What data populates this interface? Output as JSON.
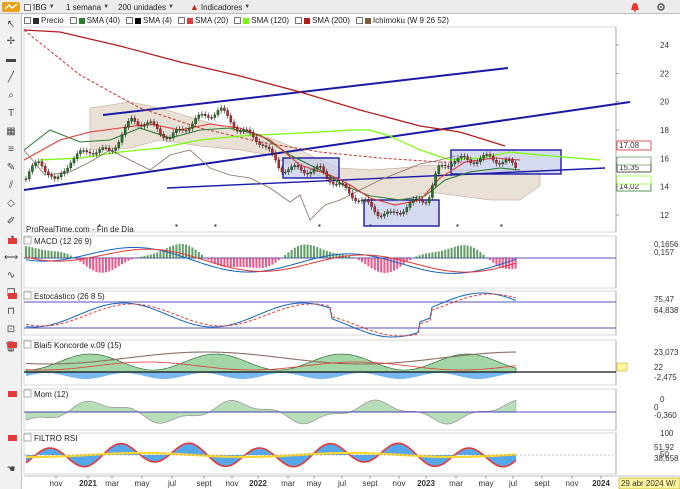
{
  "toolbar": {
    "symbol": "IBG",
    "period": "1 semana",
    "units": "200 unidades",
    "indicators_button": "Indicadores",
    "legend": [
      {
        "label": "Precio",
        "color": "#2a2a2a"
      },
      {
        "label": "SMA (40)",
        "color": "#2e7d32"
      },
      {
        "label": "SMA (4)",
        "color": "#000000"
      },
      {
        "label": "SMA (20)",
        "color": "#e53935"
      },
      {
        "label": "SMA (120)",
        "color": "#76ff03"
      },
      {
        "label": "SMA (200)",
        "color": "#b71c1c"
      },
      {
        "label": "Ichimoku (W 9 26 52)",
        "color": "#7b5e3b"
      }
    ]
  },
  "price_panel": {
    "source_label": "ProRealTime.com - Fin de Día",
    "y_ticks": [
      "24",
      "22",
      "20",
      "18",
      "16",
      "14",
      "12"
    ],
    "price_tags": [
      {
        "text": "17,08",
        "color": "#d32f2f"
      },
      {
        "text": "15,35",
        "color": "#2a2a2a"
      },
      {
        "text": "14,02",
        "color": "#2e7d32"
      }
    ]
  },
  "panels": {
    "macd": {
      "label": "MACD (12 26 9)",
      "tags": [
        "0,1656",
        "0,157"
      ]
    },
    "stochastic": {
      "label": "Estocástico (26 8 5)",
      "tags": [
        "75,47",
        "64,838"
      ]
    },
    "blai5": {
      "label": "Blai5 Koncorde v.09 (15)",
      "tags": [
        "23,073",
        "22",
        "-2,475"
      ]
    },
    "momentum": {
      "label": "Mom (12)",
      "tags": [
        "0",
        "-0,360"
      ],
      "y_ticks": [
        "0"
      ]
    },
    "rsi": {
      "label": "FILTRO RSI",
      "tags": [
        "51,92",
        "38,658"
      ],
      "y_ticks": [
        "100",
        "50"
      ]
    }
  },
  "x_axis": {
    "labels": [
      "nov",
      "2021",
      "mar",
      "may",
      "jul",
      "sept",
      "nov",
      "2022",
      "mar",
      "may",
      "jul",
      "sept",
      "nov",
      "2023",
      "mar",
      "may",
      "jul",
      "sept",
      "nov",
      "2024"
    ],
    "date_tag": "29 abr 2024 W/"
  },
  "colors": {
    "resistance_line": "#1a1aa8",
    "support_line": "#1a1aa8",
    "box_fill": "#c5cae9",
    "sma200": "#b71c1c",
    "sma40": "#2e7d32",
    "sma20": "#e53935",
    "sma120": "#76ff03",
    "cloud": "#d7c7b4",
    "candle_up": "#1e7a1e",
    "candle_down": "#c62828"
  }
}
